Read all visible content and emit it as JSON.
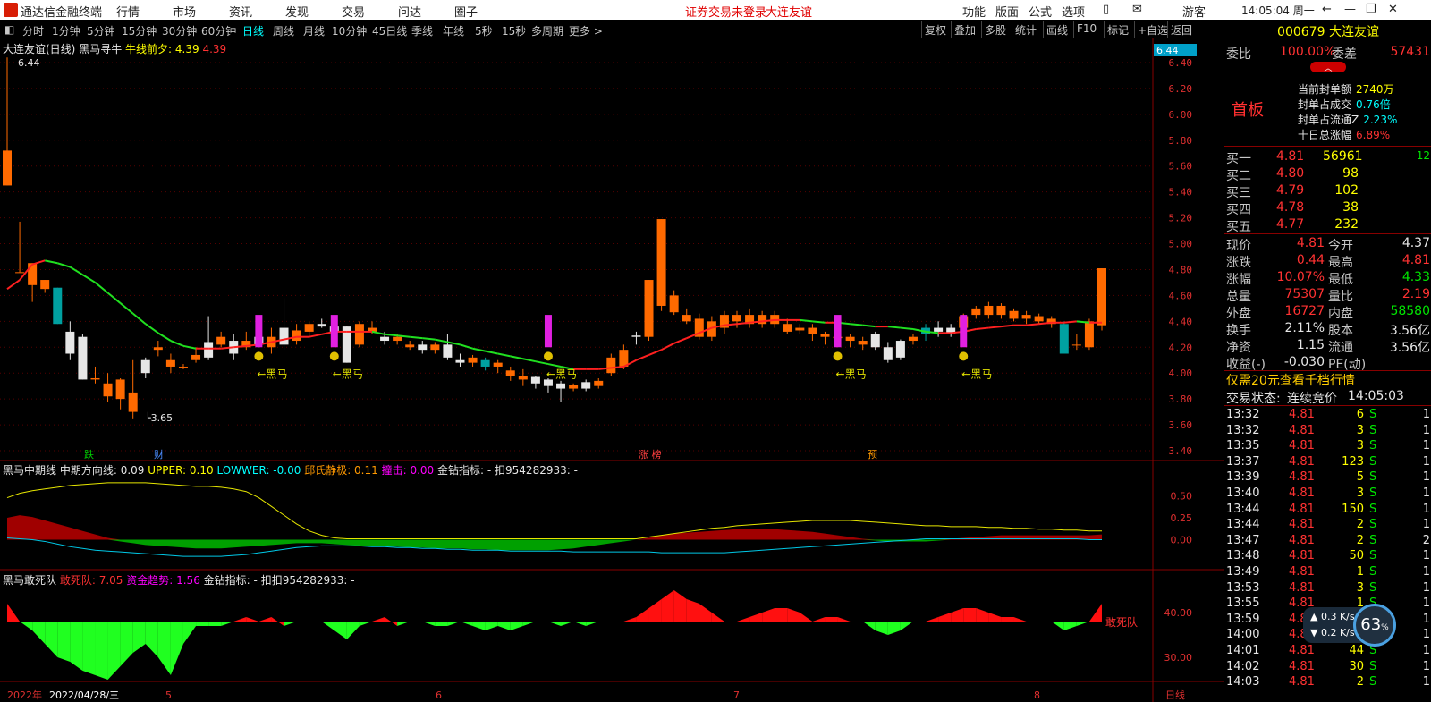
{
  "menu": {
    "app_name": "通达信金融终端",
    "items": [
      "行情",
      "市场",
      "资讯",
      "发现",
      "交易",
      "问达",
      "圈子"
    ],
    "notice1": "证券交易未登录",
    "notice2": "大连友谊",
    "right_items": [
      "功能",
      "版面",
      "公式",
      "选项"
    ],
    "guest": "游客",
    "clock": "14:05:04 周一"
  },
  "toolbar": {
    "periods": [
      "分时",
      "1分钟",
      "5分钟",
      "15分钟",
      "30分钟",
      "60分钟",
      "日线",
      "周线",
      "月线",
      "10分钟",
      "45日线",
      "季线",
      "年线",
      "5秒",
      "15秒",
      "多周期",
      "更多 >"
    ],
    "active": "日线",
    "right": [
      "复权",
      "叠加",
      "多股",
      "统计",
      "画线",
      "F10",
      "标记",
      "+自选",
      "返回"
    ]
  },
  "main_title": {
    "stock": "大连友谊(日线)",
    "indicator": "黑马寻牛",
    "label": "牛线前夕: 4.39",
    "value2": "4.39"
  },
  "price_axis": [
    "6.40",
    "6.20",
    "6.00",
    "5.80",
    "5.60",
    "5.40",
    "5.20",
    "5.00",
    "4.80",
    "4.60",
    "4.40",
    "4.20",
    "4.00",
    "3.80",
    "3.60",
    "3.40"
  ],
  "price_current": "6.44",
  "price_max_label": "6.44",
  "price_min_label": "3.65",
  "heima_label": "←黑马",
  "event_tags": [
    {
      "t": "跌",
      "c": "#00cc00"
    },
    {
      "t": "财",
      "c": "#4a8cff"
    },
    {
      "t": "涨 榜",
      "c": "#ff4040"
    },
    {
      "t": "预",
      "c": "#ff9900"
    }
  ],
  "mid_title": {
    "name": "黑马中期线",
    "line1": "中期方向线: 0.09",
    "line2": "UPPER: 0.10",
    "line3": "LOWWER: -0.00",
    "line4": "邱氏静极: 0.11",
    "line5": "撞击: 0.00",
    "line6": "金钻指标: -",
    "line7": "扣954282933: -"
  },
  "mid_axis": [
    "0.50",
    "0.25",
    "0.00"
  ],
  "low_title": {
    "name": "黑马敢死队",
    "line1": "敢死队: 7.05",
    "line2": "资金趋势: 1.56",
    "line3": "金钻指标: -",
    "line4": "扣扣954282933: -"
  },
  "low_axis": [
    "40.00",
    "30.00"
  ],
  "low_end_label": "敢死队",
  "bottom_axis": [
    "2022年",
    "2022/04/28/三",
    "5",
    "6",
    "7",
    "8",
    "日线"
  ],
  "rp": {
    "code": "000679",
    "name": "大连友谊",
    "weibi_label": "委比",
    "weibi": "100.00%",
    "weicha_label": "委差",
    "weicha": "57431",
    "board": "首板",
    "feng": [
      [
        "当前封单额",
        "2740万"
      ],
      [
        "封单占成交",
        "0.76倍"
      ],
      [
        "封单占流通Z",
        "2.23%"
      ],
      [
        "十日总涨幅",
        "6.89%"
      ]
    ],
    "bids": [
      [
        "买一",
        "4.81",
        "56961",
        "-12"
      ],
      [
        "买二",
        "4.80",
        "98",
        ""
      ],
      [
        "买三",
        "4.79",
        "102",
        ""
      ],
      [
        "买四",
        "4.78",
        "38",
        ""
      ],
      [
        "买五",
        "4.77",
        "232",
        ""
      ]
    ],
    "quote": [
      [
        "现价",
        "4.81",
        "今开",
        "4.37"
      ],
      [
        "涨跌",
        "0.44",
        "最高",
        "4.81"
      ],
      [
        "涨幅",
        "10.07%",
        "最低",
        "4.33"
      ],
      [
        "总量",
        "75307",
        "量比",
        "2.19"
      ],
      [
        "外盘",
        "16727",
        "内盘",
        "58580"
      ],
      [
        "换手",
        "2.11%",
        "股本",
        "3.56亿"
      ],
      [
        "净资",
        "1.15",
        "流通",
        "3.56亿"
      ],
      [
        "收益(-)",
        "-0.030",
        "PE(动)",
        ""
      ]
    ],
    "promo": "仅需20元查看千档行情",
    "status_label": "交易状态:",
    "status": "连续竞价",
    "status_time": "14:05:03",
    "ticks": [
      [
        "13:32",
        "4.81",
        "6",
        "S",
        "1"
      ],
      [
        "13:32",
        "4.81",
        "3",
        "S",
        "1"
      ],
      [
        "13:35",
        "4.81",
        "3",
        "S",
        "1"
      ],
      [
        "13:37",
        "4.81",
        "123",
        "S",
        "1"
      ],
      [
        "13:39",
        "4.81",
        "5",
        "S",
        "1"
      ],
      [
        "13:40",
        "4.81",
        "3",
        "S",
        "1"
      ],
      [
        "13:44",
        "4.81",
        "150",
        "S",
        "1"
      ],
      [
        "13:44",
        "4.81",
        "2",
        "S",
        "1"
      ],
      [
        "13:47",
        "4.81",
        "2",
        "S",
        "2"
      ],
      [
        "13:48",
        "4.81",
        "50",
        "S",
        "1"
      ],
      [
        "13:49",
        "4.81",
        "1",
        "S",
        "1"
      ],
      [
        "13:53",
        "4.81",
        "3",
        "S",
        "1"
      ],
      [
        "13:55",
        "4.81",
        "1",
        "S",
        "1"
      ],
      [
        "13:59",
        "4.81",
        "",
        "S",
        "1"
      ],
      [
        "14:00",
        "4.81",
        "",
        "S",
        "1"
      ],
      [
        "14:01",
        "4.81",
        "44",
        "S",
        "1"
      ],
      [
        "14:02",
        "4.81",
        "30",
        "S",
        "1"
      ],
      [
        "14:03",
        "4.81",
        "2",
        "S",
        "1"
      ]
    ],
    "net_up": "0.3",
    "net_down": "0.2",
    "net_unit": "K/s",
    "gauge": "63"
  },
  "chart_data": {
    "type": "candlestick",
    "ylim": [
      3.4,
      6.44
    ],
    "candles": [
      [
        5.45,
        5.72,
        5.45,
        6.44
      ],
      [
        4.78,
        4.78,
        4.78,
        5.17
      ],
      [
        4.68,
        4.85,
        4.55,
        4.85
      ],
      [
        4.65,
        4.72,
        4.62,
        4.72
      ],
      [
        4.66,
        4.38,
        4.38,
        4.66
      ],
      [
        4.32,
        4.15,
        4.1,
        4.4
      ],
      [
        4.28,
        3.95,
        3.95,
        4.3
      ],
      [
        3.95,
        3.96,
        3.92,
        4.05
      ],
      [
        3.82,
        3.92,
        3.78,
        4.0
      ],
      [
        3.8,
        3.95,
        3.72,
        3.96
      ],
      [
        3.7,
        3.85,
        3.65,
        4.1
      ],
      [
        4.1,
        4.0,
        3.96,
        4.12
      ],
      [
        4.18,
        4.2,
        4.13,
        4.25
      ],
      [
        4.05,
        4.1,
        4.0,
        4.15
      ],
      [
        4.05,
        4.05,
        4.03,
        4.07
      ],
      [
        4.1,
        4.14,
        4.08,
        4.2
      ],
      [
        4.24,
        4.12,
        4.1,
        4.44
      ],
      [
        4.22,
        4.28,
        4.2,
        4.32
      ],
      [
        4.25,
        4.15,
        4.1,
        4.3
      ],
      [
        4.2,
        4.25,
        4.18,
        4.32
      ],
      [
        4.28,
        4.22,
        4.2,
        4.3
      ],
      [
        4.2,
        4.28,
        4.15,
        4.35
      ],
      [
        4.35,
        4.22,
        4.18,
        4.58
      ],
      [
        4.25,
        4.33,
        4.22,
        4.38
      ],
      [
        4.32,
        4.38,
        4.28,
        4.4
      ],
      [
        4.38,
        4.36,
        4.35,
        4.42
      ],
      [
        4.36,
        4.32,
        4.3,
        4.4
      ],
      [
        4.36,
        4.08,
        4.08,
        4.36
      ],
      [
        4.22,
        4.38,
        4.2,
        4.4
      ],
      [
        4.32,
        4.35,
        4.3,
        4.4
      ],
      [
        4.28,
        4.25,
        4.22,
        4.32
      ],
      [
        4.25,
        4.28,
        4.22,
        4.3
      ],
      [
        4.2,
        4.22,
        4.18,
        4.25
      ],
      [
        4.22,
        4.18,
        4.15,
        4.25
      ],
      [
        4.18,
        4.22,
        4.15,
        4.24
      ],
      [
        4.22,
        4.12,
        4.1,
        4.3
      ],
      [
        4.1,
        4.08,
        4.05,
        4.15
      ],
      [
        4.08,
        4.12,
        4.05,
        4.14
      ],
      [
        4.1,
        4.05,
        4.02,
        4.12
      ],
      [
        4.05,
        4.08,
        4.0,
        4.1
      ],
      [
        3.98,
        4.02,
        3.94,
        4.05
      ],
      [
        3.95,
        3.98,
        3.9,
        4.03
      ],
      [
        3.97,
        3.92,
        3.88,
        3.98
      ],
      [
        3.95,
        3.9,
        3.85,
        3.96
      ],
      [
        3.92,
        3.88,
        3.78,
        3.94
      ],
      [
        3.88,
        3.91,
        3.86,
        3.92
      ],
      [
        3.93,
        3.88,
        3.86,
        3.95
      ],
      [
        3.9,
        3.94,
        3.88,
        3.96
      ],
      [
        4.0,
        4.12,
        3.98,
        4.15
      ],
      [
        4.05,
        4.18,
        4.03,
        4.22
      ],
      [
        4.29,
        4.28,
        4.22,
        4.32
      ],
      [
        4.28,
        4.72,
        4.25,
        4.72
      ],
      [
        4.52,
        5.19,
        4.48,
        5.19
      ],
      [
        4.47,
        4.6,
        4.45,
        4.64
      ],
      [
        4.4,
        4.45,
        4.38,
        4.5
      ],
      [
        4.28,
        4.42,
        4.26,
        4.46
      ],
      [
        4.28,
        4.4,
        4.25,
        4.44
      ],
      [
        4.35,
        4.45,
        4.3,
        4.48
      ],
      [
        4.4,
        4.45,
        4.35,
        4.48
      ],
      [
        4.38,
        4.45,
        4.35,
        4.5
      ],
      [
        4.38,
        4.45,
        4.35,
        4.48
      ],
      [
        4.38,
        4.45,
        4.35,
        4.48
      ],
      [
        4.32,
        4.38,
        4.3,
        4.42
      ],
      [
        4.33,
        4.35,
        4.3,
        4.38
      ],
      [
        4.3,
        4.35,
        4.25,
        4.38
      ],
      [
        4.28,
        4.3,
        4.22,
        4.32
      ],
      [
        4.27,
        4.28,
        4.2,
        4.33
      ],
      [
        4.25,
        4.28,
        4.2,
        4.3
      ],
      [
        4.22,
        4.25,
        4.18,
        4.28
      ],
      [
        4.3,
        4.2,
        4.18,
        4.32
      ],
      [
        4.2,
        4.1,
        4.08,
        4.24
      ],
      [
        4.25,
        4.12,
        4.1,
        4.26
      ],
      [
        4.25,
        4.28,
        4.22,
        4.3
      ],
      [
        4.35,
        4.3,
        4.25,
        4.38
      ],
      [
        4.35,
        4.32,
        4.28,
        4.4
      ],
      [
        4.35,
        4.3,
        4.28,
        4.38
      ],
      [
        4.35,
        4.44,
        4.32,
        4.46
      ],
      [
        4.45,
        4.5,
        4.42,
        4.52
      ],
      [
        4.45,
        4.52,
        4.42,
        4.55
      ],
      [
        4.45,
        4.52,
        4.42,
        4.54
      ],
      [
        4.42,
        4.48,
        4.4,
        4.5
      ],
      [
        4.42,
        4.45,
        4.38,
        4.48
      ],
      [
        4.4,
        4.44,
        4.38,
        4.46
      ],
      [
        4.38,
        4.42,
        4.35,
        4.44
      ],
      [
        4.38,
        4.15,
        4.15,
        4.4
      ],
      [
        4.22,
        4.22,
        4.18,
        4.3
      ],
      [
        4.2,
        4.4,
        4.18,
        4.42
      ],
      [
        4.37,
        4.81,
        4.33,
        4.81
      ]
    ],
    "ma": [
      4.65,
      4.72,
      4.84,
      4.87,
      4.85,
      4.82,
      4.76,
      4.7,
      4.62,
      4.54,
      4.46,
      4.38,
      4.31,
      4.25,
      4.21,
      4.19,
      4.19,
      4.19,
      4.2,
      4.21,
      4.22,
      4.24,
      4.26,
      4.28,
      4.28,
      4.3,
      4.32,
      4.32,
      4.32,
      4.32,
      4.3,
      4.29,
      4.28,
      4.27,
      4.26,
      4.24,
      4.22,
      4.19,
      4.17,
      4.15,
      4.13,
      4.11,
      4.09,
      4.07,
      4.05,
      4.03,
      4.03,
      4.03,
      4.04,
      4.05,
      4.1,
      4.14,
      4.18,
      4.23,
      4.27,
      4.31,
      4.35,
      4.37,
      4.38,
      4.39,
      4.4,
      4.41,
      4.41,
      4.41,
      4.4,
      4.39,
      4.39,
      4.38,
      4.37,
      4.36,
      4.36,
      4.35,
      4.34,
      4.32,
      4.31,
      4.31,
      4.32,
      4.34,
      4.35,
      4.36,
      4.37,
      4.37,
      4.38,
      4.39,
      4.39,
      4.4,
      4.39,
      4.39
    ],
    "mid_red": [
      0.25,
      0.28,
      0.26,
      0.22,
      0.18,
      0.14,
      0.1,
      0.06,
      0.02,
      0,
      0,
      0,
      0,
      0,
      0,
      0,
      0,
      0,
      0,
      0,
      0,
      0,
      0,
      0,
      0,
      0,
      0,
      0,
      0,
      0,
      0,
      0,
      0,
      0,
      0,
      0,
      0,
      0,
      0,
      0,
      0,
      0,
      0,
      0,
      0,
      0,
      0,
      0,
      0,
      0,
      0,
      0.02,
      0.05,
      0.07,
      0.08,
      0.09,
      0.1,
      0.11,
      0.12,
      0.12,
      0.12,
      0.12,
      0.11,
      0.1,
      0.09,
      0.07,
      0.05,
      0.03,
      0.01,
      0,
      0,
      0,
      0,
      0,
      0,
      0.01,
      0.02,
      0.03,
      0.04,
      0.05,
      0.05,
      0.05,
      0.05,
      0.05,
      0.05,
      0.05,
      0.05,
      0.06
    ],
    "mid_green": [
      0,
      0,
      0,
      0,
      0,
      0,
      0,
      0,
      0,
      -0.02,
      -0.04,
      -0.06,
      -0.07,
      -0.08,
      -0.09,
      -0.1,
      -0.1,
      -0.1,
      -0.09,
      -0.08,
      -0.07,
      -0.06,
      -0.05,
      -0.04,
      -0.04,
      -0.04,
      -0.05,
      -0.06,
      -0.07,
      -0.07,
      -0.08,
      -0.08,
      -0.09,
      -0.09,
      -0.1,
      -0.1,
      -0.1,
      -0.11,
      -0.11,
      -0.12,
      -0.12,
      -0.12,
      -0.12,
      -0.12,
      -0.11,
      -0.1,
      -0.08,
      -0.06,
      -0.04,
      -0.02,
      0,
      0,
      0,
      0,
      0,
      0,
      0,
      0,
      0,
      0,
      0,
      0,
      0,
      0,
      0,
      0,
      0,
      0,
      0,
      -0.01,
      -0.02,
      -0.02,
      -0.02,
      -0.02,
      -0.01,
      0,
      0,
      0,
      0,
      0,
      0,
      0,
      0,
      0,
      0,
      0,
      0,
      0
    ],
    "mid_yellow": [
      0.48,
      0.53,
      0.56,
      0.58,
      0.6,
      0.62,
      0.63,
      0.64,
      0.65,
      0.65,
      0.65,
      0.65,
      0.64,
      0.63,
      0.62,
      0.61,
      0.61,
      0.6,
      0.58,
      0.55,
      0.48,
      0.38,
      0.28,
      0.18,
      0.1,
      0.05,
      0.02,
      0.01,
      0.01,
      0.01,
      0.01,
      0.01,
      0.01,
      0.01,
      0.01,
      0.01,
      0.01,
      0.01,
      0.01,
      0.01,
      0.01,
      0.01,
      0.01,
      0.01,
      0.01,
      0.01,
      0.01,
      0.01,
      0.01,
      0.01,
      0.01,
      0.03,
      0.05,
      0.07,
      0.09,
      0.11,
      0.13,
      0.14,
      0.16,
      0.17,
      0.18,
      0.19,
      0.2,
      0.21,
      0.22,
      0.22,
      0.22,
      0.22,
      0.21,
      0.2,
      0.19,
      0.18,
      0.17,
      0.16,
      0.16,
      0.15,
      0.15,
      0.15,
      0.14,
      0.14,
      0.13,
      0.13,
      0.12,
      0.12,
      0.11,
      0.11,
      0.1,
      0.1
    ],
    "mid_cyan": [
      0.02,
      0.01,
      0,
      -0.02,
      -0.05,
      -0.08,
      -0.1,
      -0.12,
      -0.13,
      -0.14,
      -0.15,
      -0.16,
      -0.17,
      -0.18,
      -0.19,
      -0.19,
      -0.19,
      -0.19,
      -0.18,
      -0.17,
      -0.15,
      -0.13,
      -0.11,
      -0.09,
      -0.08,
      -0.07,
      -0.07,
      -0.07,
      -0.07,
      -0.08,
      -0.08,
      -0.09,
      -0.09,
      -0.1,
      -0.1,
      -0.11,
      -0.11,
      -0.12,
      -0.12,
      -0.12,
      -0.13,
      -0.13,
      -0.13,
      -0.13,
      -0.13,
      -0.14,
      -0.14,
      -0.14,
      -0.14,
      -0.14,
      -0.14,
      -0.14,
      -0.15,
      -0.15,
      -0.15,
      -0.15,
      -0.15,
      -0.15,
      -0.14,
      -0.13,
      -0.12,
      -0.11,
      -0.1,
      -0.09,
      -0.08,
      -0.07,
      -0.06,
      -0.05,
      -0.04,
      -0.03,
      -0.02,
      -0.01,
      0,
      0.01,
      0.01,
      0.01,
      0.01,
      0.01,
      0.01,
      0.01,
      0.01,
      0.01,
      0.01,
      0.01,
      0.01,
      0.01,
      0,
      0
    ],
    "low": [
      42,
      38,
      36,
      33,
      30,
      29,
      27,
      26,
      25,
      28,
      31,
      33,
      30,
      26,
      33,
      37,
      37,
      37,
      38,
      39,
      38,
      39,
      37,
      38,
      38,
      38,
      36,
      34,
      37,
      38,
      39,
      37,
      38,
      38,
      37,
      37,
      38,
      37,
      36,
      37,
      36,
      37,
      38,
      38,
      37,
      38,
      37,
      38,
      38,
      38,
      39,
      41,
      43,
      45,
      43,
      42,
      40,
      38,
      38,
      39,
      40,
      41,
      41,
      40,
      38,
      39,
      39,
      38,
      38,
      36,
      35,
      36,
      38,
      38,
      39,
      40,
      41,
      41,
      40,
      39,
      39,
      38,
      38,
      38,
      36,
      37,
      38,
      42
    ]
  },
  "heima_idx": [
    20,
    26,
    43,
    66,
    76
  ]
}
